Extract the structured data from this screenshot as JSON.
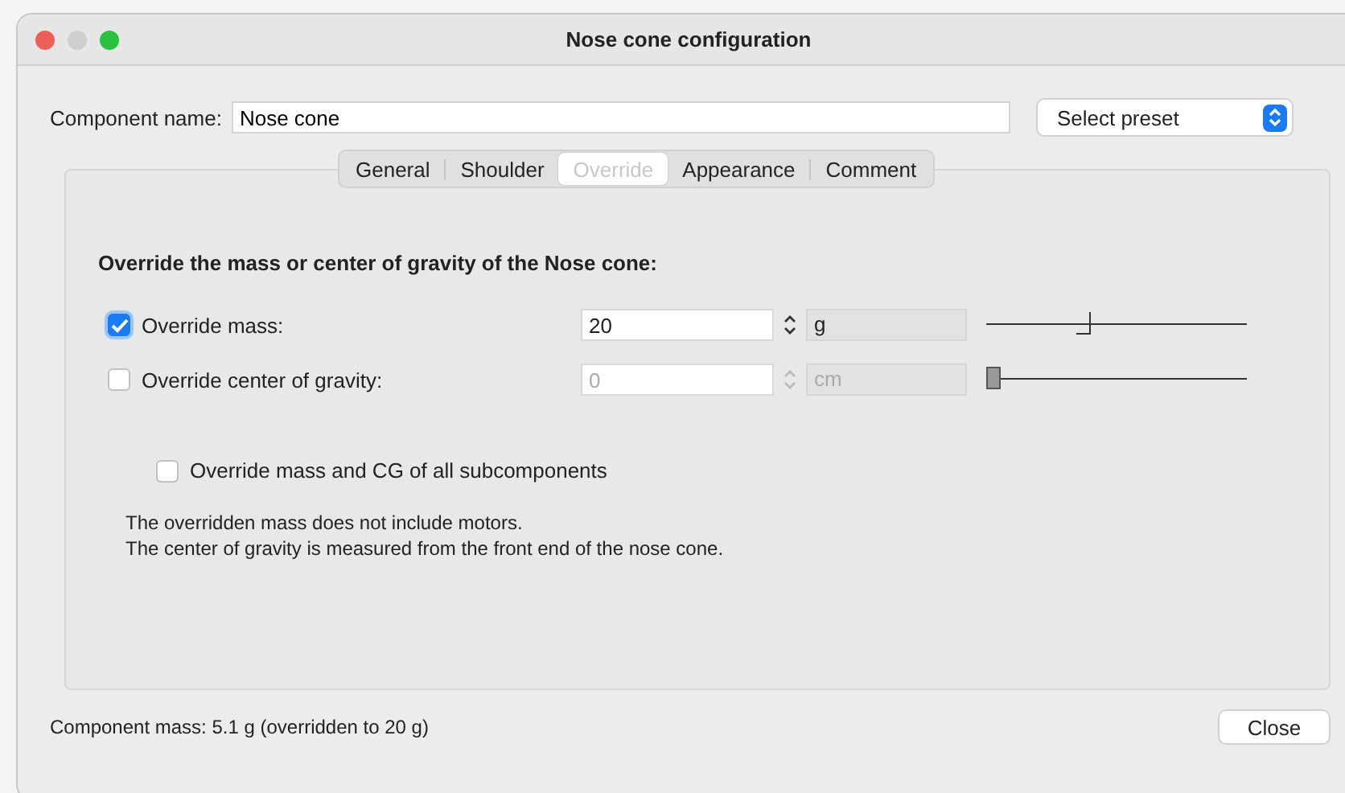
{
  "window": {
    "title": "Nose cone configuration"
  },
  "component_name": {
    "label": "Component name:",
    "value": "Nose cone"
  },
  "preset": {
    "label": "Select preset"
  },
  "tabs": [
    {
      "label": "General",
      "selected": false
    },
    {
      "label": "Shoulder",
      "selected": false
    },
    {
      "label": "Override",
      "selected": true
    },
    {
      "label": "Appearance",
      "selected": false
    },
    {
      "label": "Comment",
      "selected": false
    }
  ],
  "heading": "Override the mass or center of gravity of the Nose cone:",
  "overrides": [
    {
      "label": "Override mass:",
      "checked": true,
      "value": "20",
      "unit": "g",
      "level": 0.37
    },
    {
      "label": "Override center of gravity:",
      "checked": false,
      "value": "0",
      "unit": "cm",
      "level": 0
    }
  ],
  "subcomponents": {
    "label": "Override mass and CG of all subcomponents",
    "checked": false
  },
  "notes": [
    "The overridden mass does not include motors.",
    "The center of gravity is measured from the front end of the nose cone."
  ],
  "status": "Component mass: 5.1 g (overridden to 20 g)",
  "buttons": [
    "Close"
  ]
}
